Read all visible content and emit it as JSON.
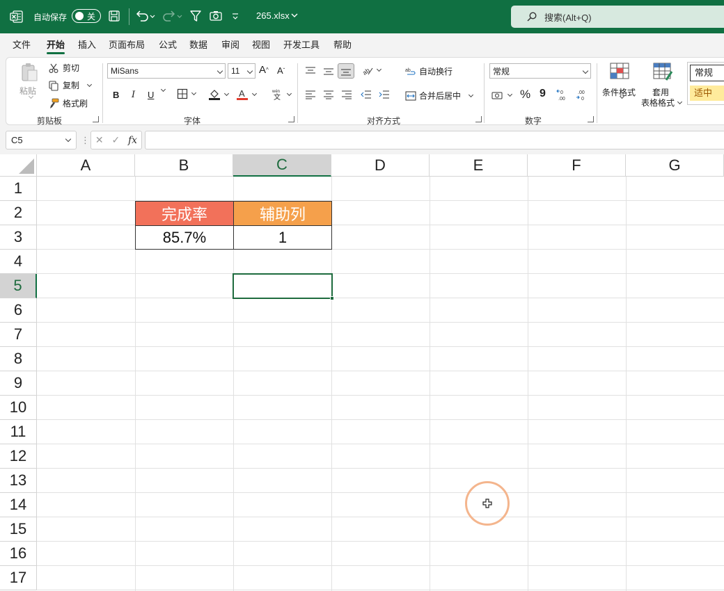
{
  "titlebar": {
    "autosave_label": "自动保存",
    "autosave_state": "关",
    "filename": "265.xlsx",
    "search_placeholder": "搜索(Alt+Q)"
  },
  "menu": {
    "tabs": [
      "文件",
      "开始",
      "插入",
      "页面布局",
      "公式",
      "数据",
      "审阅",
      "视图",
      "开发工具",
      "帮助"
    ],
    "active": "开始"
  },
  "ribbon": {
    "clipboard": {
      "paste": "粘贴",
      "cut": "剪切",
      "copy": "复制",
      "format_painter": "格式刷",
      "label": "剪贴板"
    },
    "font": {
      "name": "MiSans",
      "size": "11",
      "bold": "B",
      "italic": "I",
      "underline": "U",
      "label": "字体"
    },
    "alignment": {
      "wrap_text": "自动换行",
      "merge_center": "合并后居中",
      "label": "对齐方式"
    },
    "number": {
      "format": "常规",
      "percent": "%",
      "comma": "9",
      "label": "数字"
    },
    "styles": {
      "conditional_formatting": "条件格式",
      "format_as_table_1": "套用",
      "format_as_table_2": "表格格式",
      "style_normal": "常规",
      "style_neutral": "适中"
    }
  },
  "formula_bar": {
    "name_box": "C5",
    "fx": "fx",
    "content": ""
  },
  "sheet": {
    "columns": [
      "A",
      "B",
      "C",
      "D",
      "E",
      "F",
      "G"
    ],
    "rows": [
      "1",
      "2",
      "3",
      "4",
      "5",
      "6",
      "7",
      "8",
      "9",
      "10",
      "11",
      "12",
      "13",
      "14",
      "15",
      "16",
      "17"
    ],
    "selected_column": "C",
    "selected_row": "5",
    "cells": {
      "B2": "完成率",
      "C2": "辅助列",
      "B3": "85.7%",
      "C3": "1"
    }
  },
  "colors": {
    "excel_green": "#107042",
    "header_b2": "#f2715a",
    "header_c2": "#f5a04b",
    "cursor_ring": "#f4b58d"
  }
}
